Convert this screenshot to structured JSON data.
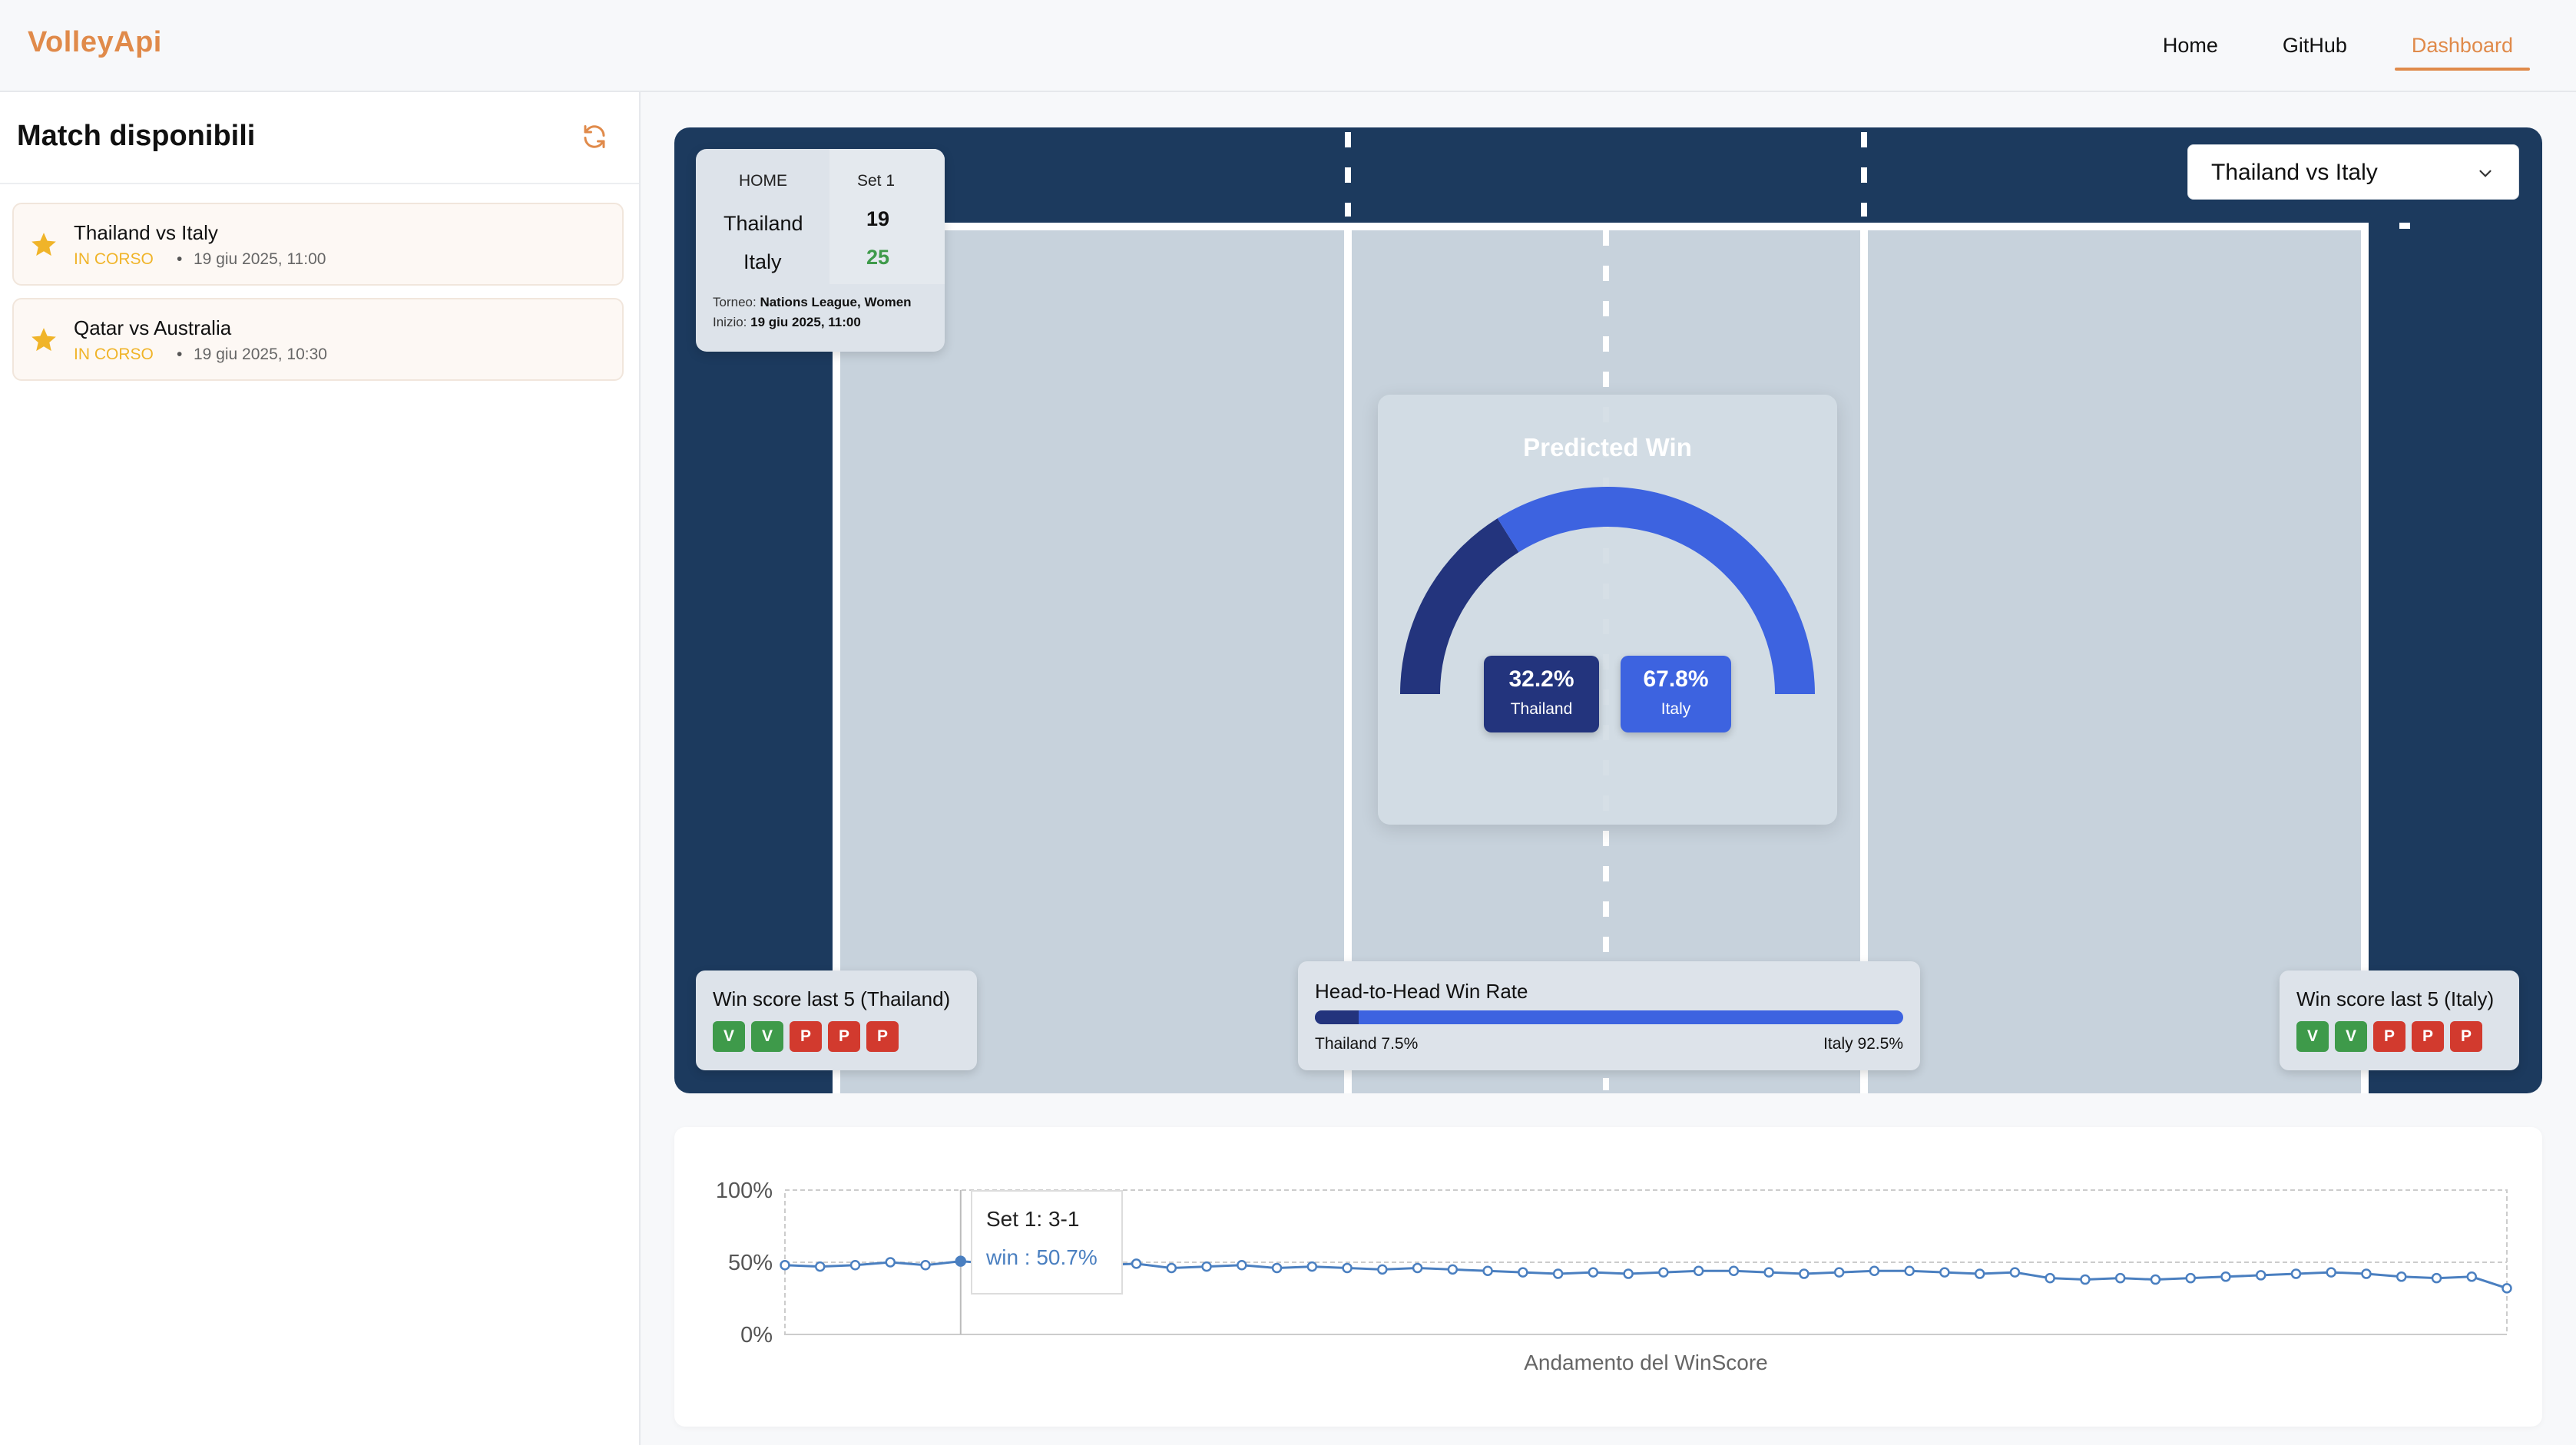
{
  "nav": {
    "brand": "VolleyApi",
    "links": [
      {
        "label": "Home",
        "active": false
      },
      {
        "label": "GitHub",
        "active": false
      },
      {
        "label": "Dashboard",
        "active": true
      }
    ]
  },
  "sidebar": {
    "title": "Match disponibili",
    "matches": [
      {
        "name": "Thailand vs Italy",
        "status": "IN CORSO",
        "time": "19 giu 2025, 11:00"
      },
      {
        "name": "Qatar vs Australia",
        "status": "IN CORSO",
        "time": "19 giu 2025, 10:30"
      }
    ]
  },
  "scoreboard": {
    "home_label": "HOME",
    "set_label": "Set 1",
    "teams": [
      {
        "name": "Thailand",
        "score": "19"
      },
      {
        "name": "Italy",
        "score": "25"
      }
    ],
    "tournament_label": "Torneo:",
    "tournament": "Nations League, Women",
    "start_label": "Inizio:",
    "start": "19 giu 2025, 11:00"
  },
  "match_select": {
    "value": "Thailand vs Italy"
  },
  "prediction": {
    "title": "Predicted Win",
    "home": {
      "pct": "32.2%",
      "team": "Thailand",
      "fraction": 0.322
    },
    "away": {
      "pct": "67.8%",
      "team": "Italy",
      "fraction": 0.678
    }
  },
  "last5_home": {
    "title": "Win score last 5 (Thailand)",
    "results": [
      "V",
      "V",
      "P",
      "P",
      "P"
    ]
  },
  "last5_away": {
    "title": "Win score last 5 (Italy)",
    "results": [
      "V",
      "V",
      "P",
      "P",
      "P"
    ]
  },
  "h2h": {
    "title": "Head-to-Head Win Rate",
    "home_label": "Thailand 7.5%",
    "away_label": "Italy 92.5%",
    "home_fraction": 0.075
  },
  "colors": {
    "accent": "#e08a4a",
    "court_dark": "#1c3a5e",
    "home_blue": "#23347d",
    "away_blue": "#3d63e0",
    "win": "#3e9a4a",
    "loss": "#d23a2e",
    "live": "#f0b429",
    "line": "#4a7fc0"
  },
  "tooltip": {
    "title": "Set 1: 3-1",
    "value": "win : 50.7%"
  },
  "chart_data": {
    "type": "line",
    "xlabel": "Andamento del WinScore",
    "ylabel": "",
    "yticks": [
      "0%",
      "50%",
      "100%"
    ],
    "ylim": [
      0,
      100
    ],
    "series": [
      {
        "values": [
          48,
          47,
          48,
          50,
          48,
          50.7,
          49,
          48,
          49,
          48,
          49,
          46,
          47,
          48,
          46,
          47,
          46,
          45,
          46,
          45,
          44,
          43,
          42,
          43,
          42,
          43,
          44,
          44,
          43,
          42,
          43,
          44,
          44,
          43,
          42,
          43,
          39,
          38,
          39,
          38,
          39,
          40,
          41,
          42,
          43,
          42,
          40,
          39,
          40,
          32
        ]
      }
    ],
    "highlight_index": 5,
    "grid": true
  }
}
